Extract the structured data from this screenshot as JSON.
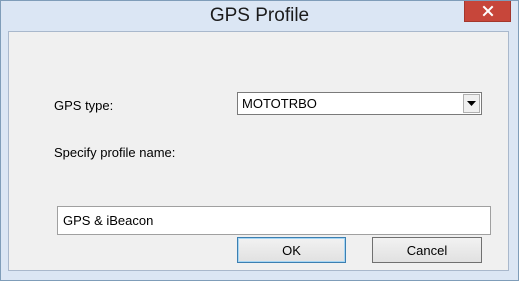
{
  "window": {
    "title": "GPS Profile",
    "close_icon": "close-icon"
  },
  "form": {
    "gps_type_label": "GPS type:",
    "gps_type_value": "MOTOTRBO",
    "profile_name_label": "Specify profile name:",
    "profile_name_value": "GPS & iBeacon"
  },
  "buttons": {
    "ok_label": "OK",
    "cancel_label": "Cancel"
  },
  "colors": {
    "close_button": "#c7463a",
    "frame": "#dbe6f4",
    "client": "#f0f0f0"
  }
}
